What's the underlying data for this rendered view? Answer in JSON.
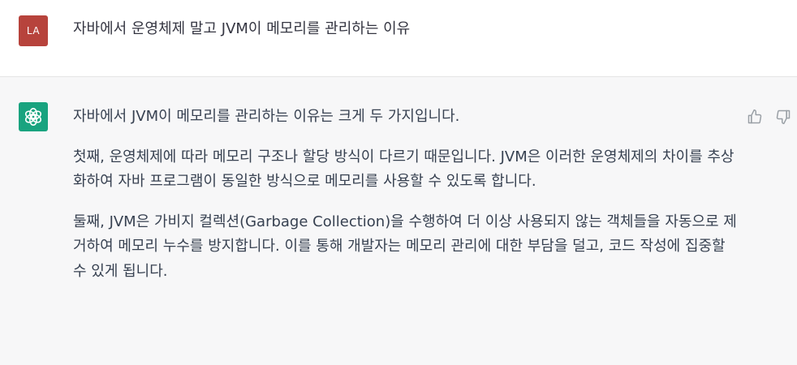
{
  "user": {
    "avatar_initials": "LA",
    "avatar_color": "#b7433c",
    "message": "자바에서 운영체제 말고 JVM이 메모리를 관리하는 이유"
  },
  "assistant": {
    "avatar_icon": "openai-logo-icon",
    "avatar_color": "#19a37f",
    "paragraphs": [
      "자바에서 JVM이 메모리를 관리하는 이유는 크게 두 가지입니다.",
      "첫째, 운영체제에 따라 메모리 구조나 할당 방식이 다르기 때문입니다. JVM은 이러한 운영체제의 차이를 추상화하여 자바 프로그램이 동일한 방식으로 메모리를 사용할 수 있도록 합니다.",
      "둘째, JVM은 가비지 컬렉션(Garbage Collection)을 수행하여 더 이상 사용되지 않는 객체들을 자동으로 제거하여 메모리 누수를 방지합니다. 이를 통해 개발자는 메모리 관리에 대한 부담을 덜고, 코드 작성에 집중할 수 있게 됩니다."
    ],
    "feedback": {
      "thumb_up_icon": "thumbs-up-icon",
      "thumb_down_icon": "thumbs-down-icon"
    }
  }
}
